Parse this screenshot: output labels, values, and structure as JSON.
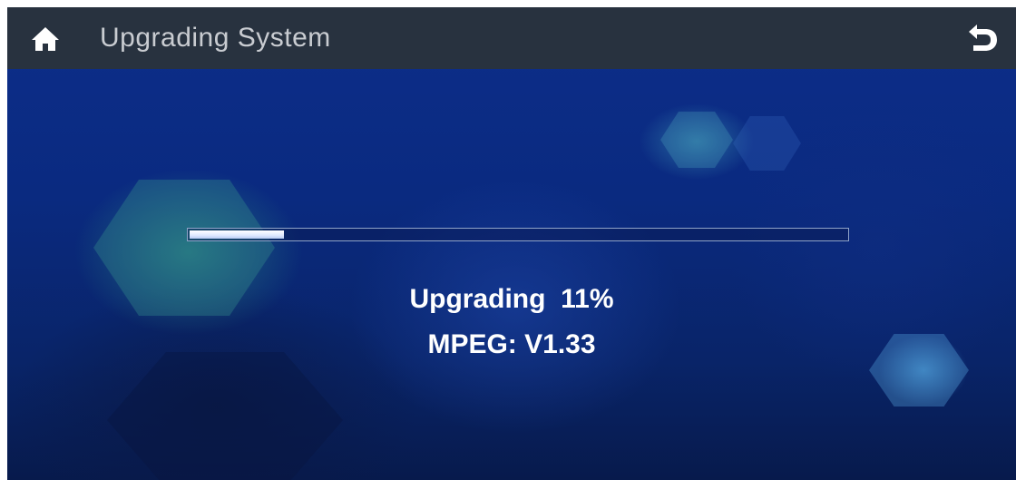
{
  "header": {
    "title": "Upgrading System",
    "home_icon": "home-icon",
    "back_icon": "back-icon"
  },
  "progress": {
    "percent": 11,
    "status_text": "Upgrading  11%",
    "version_text": "MPEG: V1.33"
  },
  "colors": {
    "titlebar": "#28323f",
    "title_text": "#c9ccd1",
    "background": "#0b2a7a",
    "progress_fill": "#ffffff"
  }
}
